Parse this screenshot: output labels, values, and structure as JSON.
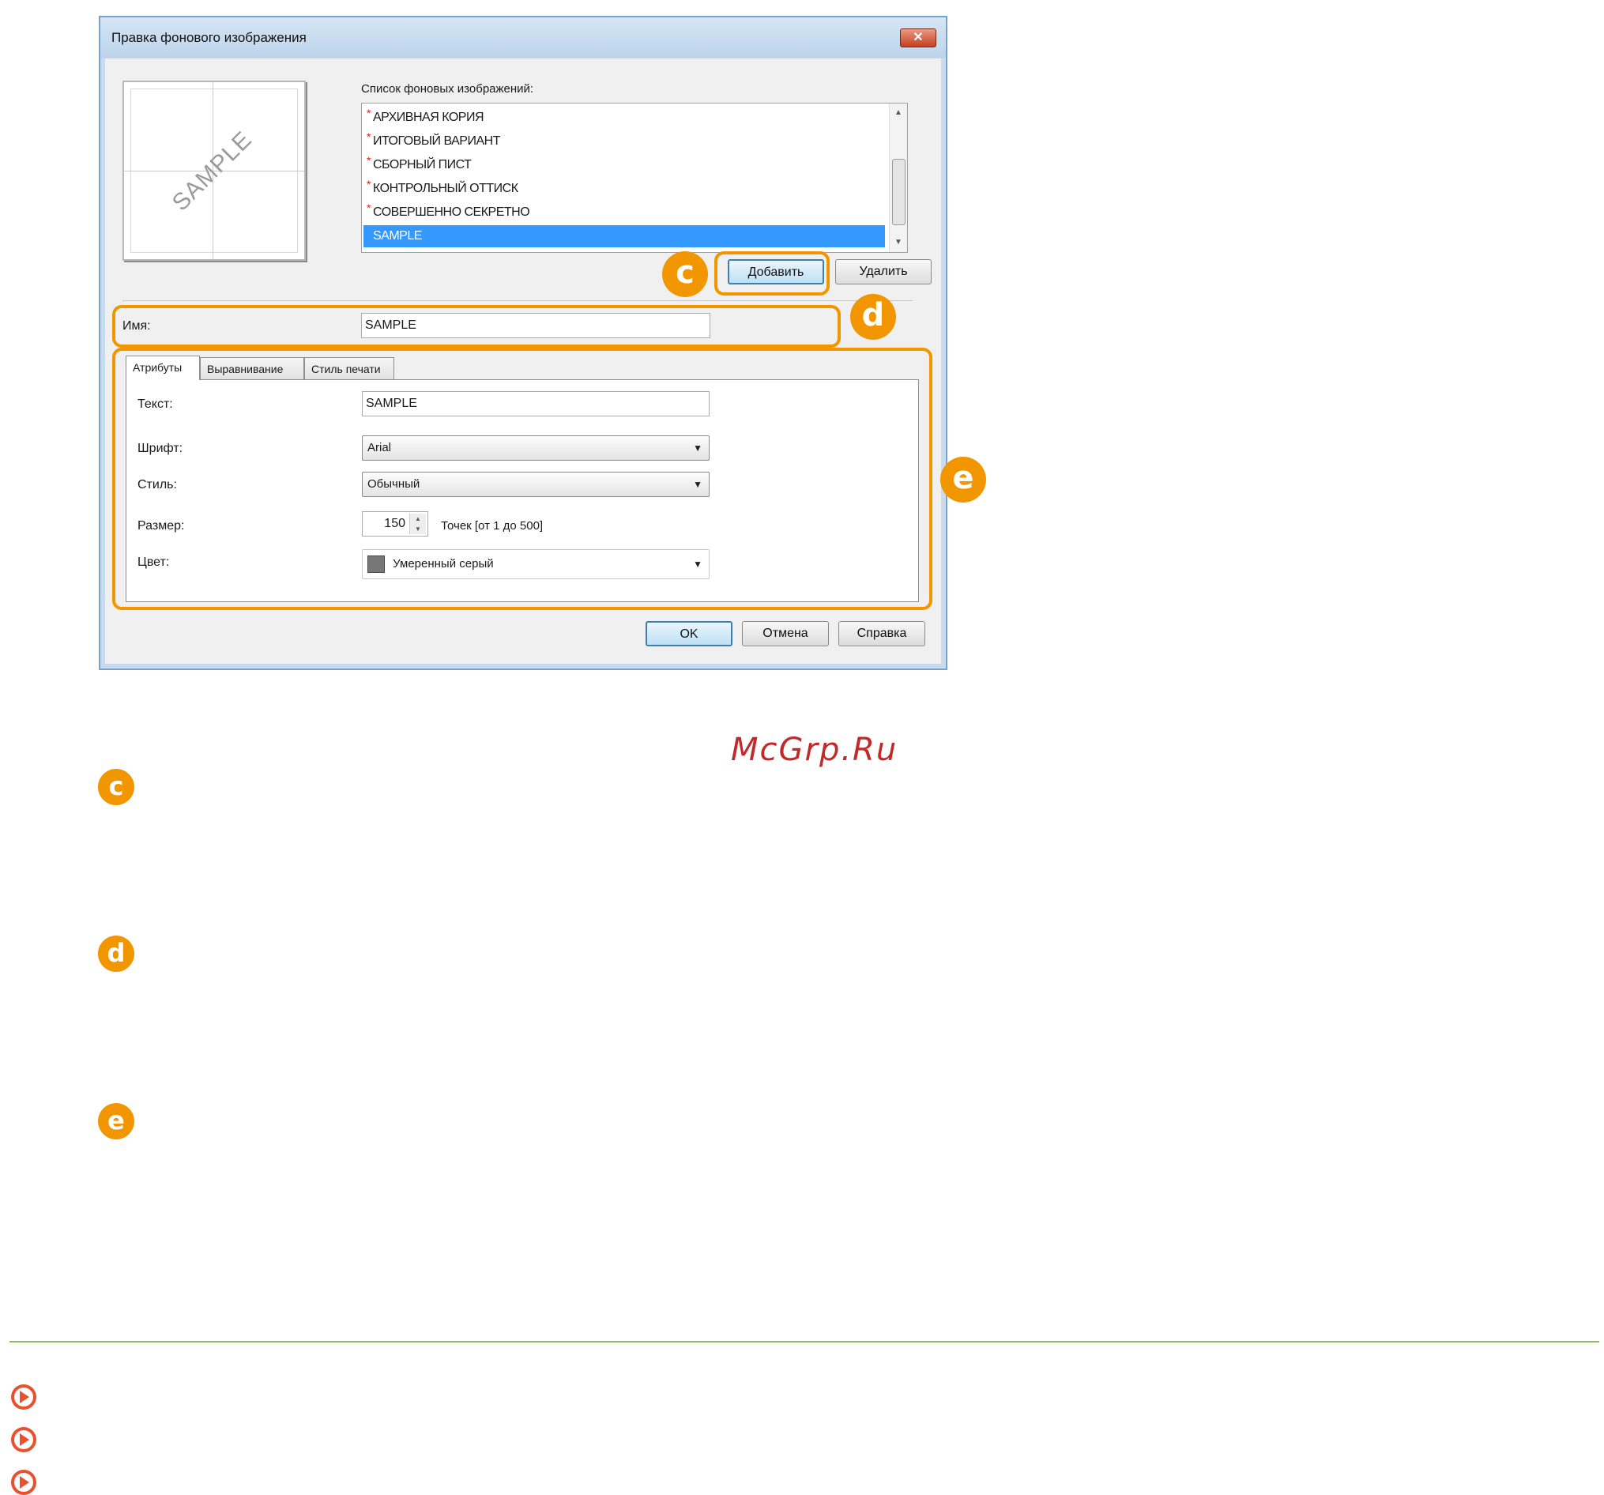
{
  "dialog": {
    "title": "Правка фонового изображения",
    "close_label": "✕",
    "preview_text": "SAMPLE",
    "list_label": "Список фоновых изображений:",
    "list_items": [
      {
        "label": "АРХИВНАЯ КОРИЯ",
        "star": "*"
      },
      {
        "label": "ИТОГОВЫЙ ВАРИАНТ",
        "star": "*"
      },
      {
        "label": "СБОРНЫЙ ПИСТ",
        "star": "*"
      },
      {
        "label": "КОНТРОЛЬНЫЙ ОТТИСК",
        "star": "*"
      },
      {
        "label": "СОВЕРШЕННО СЕКРЕТНО",
        "star": "*"
      },
      {
        "label": "SAMPLE",
        "star": ""
      }
    ],
    "add_button": "Добавить",
    "delete_button": "Удалить",
    "name_label": "Имя:",
    "name_value": "SAMPLE",
    "tabs": [
      "Атрибуты",
      "Выравнивание",
      "Стиль печати"
    ],
    "text_label": "Текст:",
    "text_value": "SAMPLE",
    "font_label": "Шрифт:",
    "font_value": "Arial",
    "style_label": "Стиль:",
    "style_value": "Обычный",
    "size_label": "Размер:",
    "size_value": "150",
    "size_hint": "Точек [от 1 до 500]",
    "color_label": "Цвет:",
    "color_value": "Умеренный серый",
    "ok_button": "OK",
    "cancel_button": "Отмена",
    "help_button": "Справка"
  },
  "callouts": {
    "c": "c",
    "d": "d",
    "e": "e"
  },
  "watermark": "McGrp.Ru",
  "colors": {
    "accent": "#f29600",
    "selection": "#3399ff",
    "footer_rule": "#8fbf62",
    "link_icon": "#e8502e"
  }
}
